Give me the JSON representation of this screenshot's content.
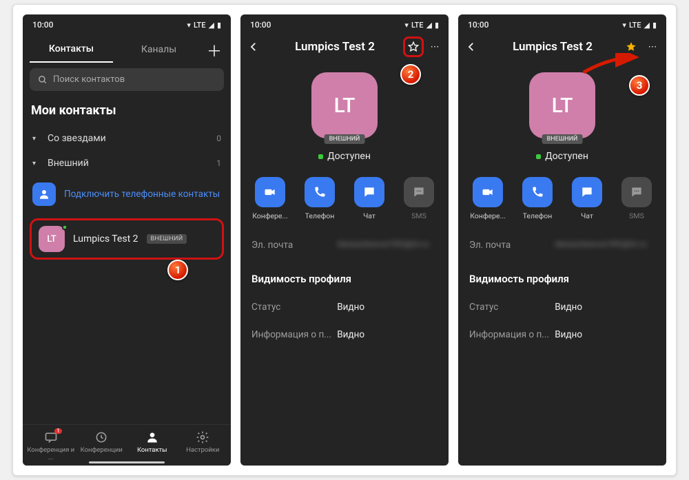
{
  "status": {
    "time": "10:00",
    "net": "LTE"
  },
  "contacts": {
    "tabs": {
      "contacts": "Контакты",
      "channels": "Каналы"
    },
    "search_placeholder": "Поиск контактов",
    "my_contacts": "Мои контакты",
    "groups": {
      "starred": {
        "label": "Со звездами",
        "count": "0"
      },
      "external": {
        "label": "Внешний",
        "count": "1"
      }
    },
    "connect": "Подключить телефонные контакты",
    "contact": {
      "initials": "LT",
      "name": "Lumpics Test 2",
      "badge": "ВНЕШНИЙ"
    },
    "nav": {
      "conf_chat": "Конференция и ...",
      "conferences": "Конференции",
      "contacts": "Контакты",
      "settings": "Настройки",
      "badge": "1"
    }
  },
  "profile": {
    "title": "Lumpics Test 2",
    "initials": "LT",
    "badge": "ВНЕШНИЙ",
    "presence": "Доступен",
    "actions": {
      "conference": "Конфере...",
      "phone": "Телефон",
      "chat": "Чат",
      "sms": "SMS"
    },
    "email_key": "Эл. почта",
    "email_val": "dianazuhanova1992@lm.ru",
    "visibility_header": "Видимость профиля",
    "status_key": "Статус",
    "status_val": "Видно",
    "info_key": "Информация о п...",
    "info_val": "Видно"
  },
  "markers": {
    "m1": "1",
    "m2": "2",
    "m3": "3"
  }
}
